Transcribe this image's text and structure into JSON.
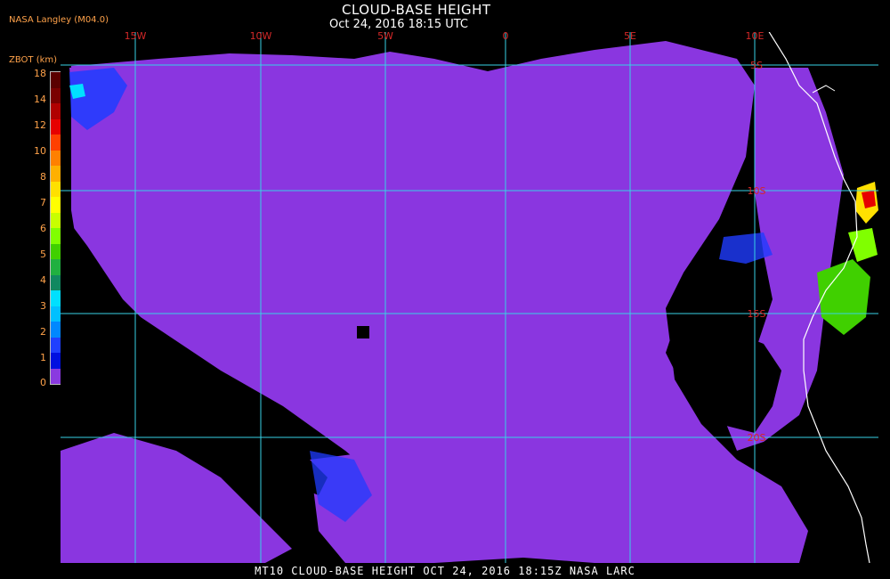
{
  "header": {
    "title": "CLOUD-BASE HEIGHT",
    "datetime": "Oct 24, 2016 18:15 UTC",
    "credit": "NASA Langley (M04.0)"
  },
  "colorbar": {
    "label": "ZBOT (km)",
    "ticks": [
      "18",
      "14",
      "12",
      "10",
      "8",
      "7",
      "6",
      "5",
      "4",
      "3",
      "2",
      "1",
      "0"
    ],
    "colors": [
      "#5a0000",
      "#7a0000",
      "#b00000",
      "#e60000",
      "#ff4000",
      "#ff8000",
      "#ffb000",
      "#ffe000",
      "#ffff00",
      "#c8ff00",
      "#80ff00",
      "#40d000",
      "#20b040",
      "#108860",
      "#00e0ff",
      "#00c0ff",
      "#0088ff",
      "#2040ff",
      "#0010e0",
      "#8a3ae0"
    ]
  },
  "map": {
    "lon_labels": [
      "15W",
      "10W",
      "5W",
      "0",
      "5E",
      "10E"
    ],
    "lat_labels": [
      "5S",
      "10S",
      "15S",
      "20S"
    ],
    "grid_color": "#37d2e6",
    "cloud_color": "#8a36e0",
    "coast_color": "#ffffff"
  },
  "footer": {
    "text": "MT10  CLOUD-BASE HEIGHT  OCT 24, 2016 18:15Z  NASA LARC"
  }
}
